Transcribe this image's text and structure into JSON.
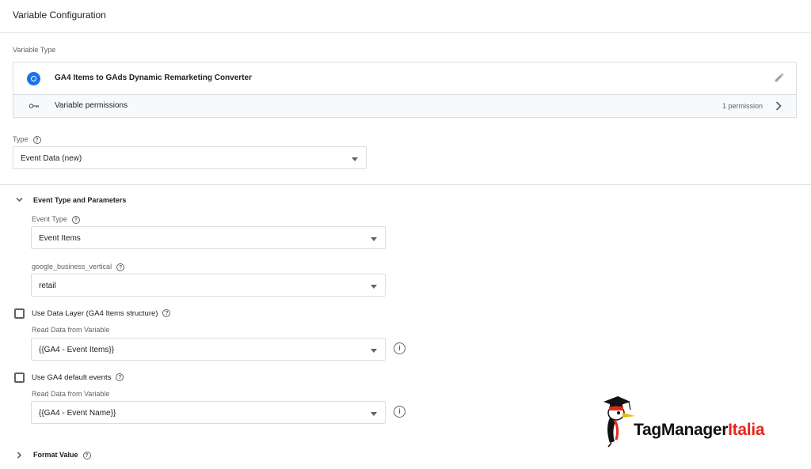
{
  "header": {
    "title": "Variable Configuration"
  },
  "variable_type": {
    "label": "Variable Type",
    "name": "GA4 Items to GAds Dynamic Remarketing Converter",
    "permissions_label": "Variable permissions",
    "permissions_count": "1 permission"
  },
  "type_field": {
    "label": "Type",
    "value": "Event Data (new)"
  },
  "event_section": {
    "title": "Event Type and Parameters",
    "event_type": {
      "label": "Event Type",
      "value": "Event Items"
    },
    "business_vertical": {
      "label": "google_business_vertical",
      "value": "retail"
    },
    "data_layer": {
      "checkbox_label": "Use Data Layer (GA4 Items structure)",
      "read_label": "Read Data from Variable",
      "value": "{{GA4 - Event Items}}"
    },
    "default_events": {
      "checkbox_label": "Use GA4 default events",
      "read_label": "Read Data from Variable",
      "value": "{{GA4 - Event Name}}"
    }
  },
  "format_section": {
    "title": "Format Value"
  },
  "logo": {
    "part1": "TagManager",
    "part2": "Italia"
  },
  "colors": {
    "accent": "#1a73e8",
    "logo_red": "#e8271a"
  }
}
